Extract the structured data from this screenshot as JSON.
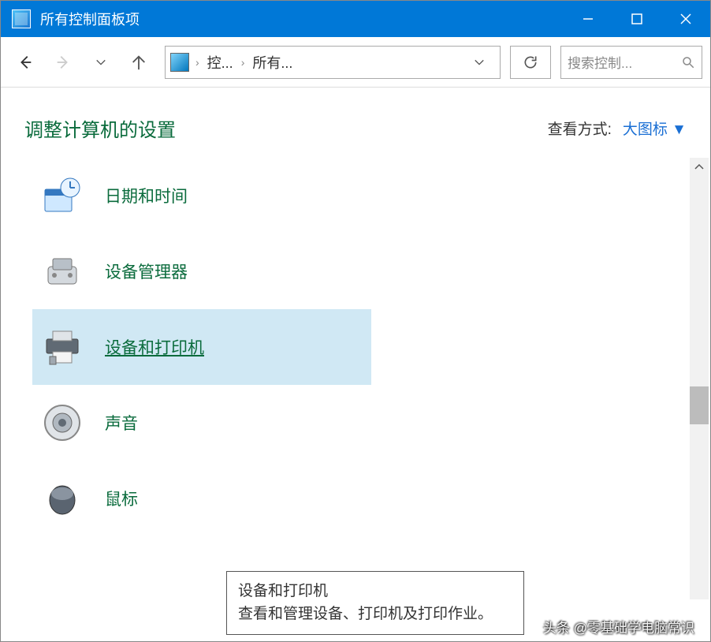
{
  "window": {
    "title": "所有控制面板项"
  },
  "breadcrumb": {
    "item1": "控...",
    "item2": "所有..."
  },
  "search": {
    "placeholder": "搜索控制..."
  },
  "header": {
    "title": "调整计算机的设置"
  },
  "view": {
    "label": "查看方式:",
    "value": "大图标 ▼"
  },
  "items": {
    "0": {
      "label": "日期和时间"
    },
    "1": {
      "label": "设备管理器"
    },
    "2": {
      "label": "设备和打印机"
    },
    "3": {
      "label": "声音"
    },
    "4": {
      "label": "鼠标"
    }
  },
  "tooltip": {
    "title": "设备和打印机",
    "body": "查看和管理设备、打印机及打印作业。"
  },
  "watermark": "头条 @零基础学电脑常识"
}
